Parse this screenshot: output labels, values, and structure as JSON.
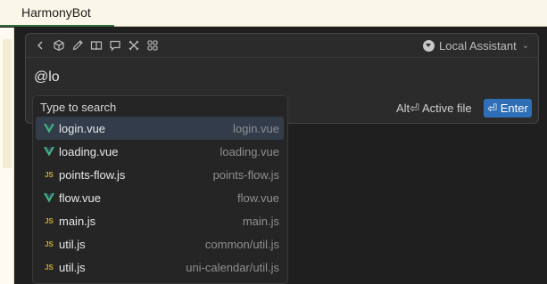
{
  "window": {
    "title": "HarmonyBot"
  },
  "toolbar": {
    "icons": [
      "chevron-left-icon",
      "cube-icon",
      "pencil-icon",
      "book-icon",
      "comment-icon",
      "tools-icon",
      "grid-icon"
    ],
    "assistant": {
      "label": "Local Assistant",
      "icon": "assistant-icon",
      "chevron": "⌄"
    }
  },
  "input": {
    "value": "@lo"
  },
  "actions": {
    "active_file": "Alt⏎ Active file",
    "enter": "⏎ Enter"
  },
  "dropdown": {
    "header": "Type to search",
    "items": [
      {
        "name": "login.vue",
        "path": "login.vue",
        "type": "vue",
        "selected": true
      },
      {
        "name": "loading.vue",
        "path": "loading.vue",
        "type": "vue",
        "selected": false
      },
      {
        "name": "points-flow.js",
        "path": "points-flow.js",
        "type": "js",
        "selected": false
      },
      {
        "name": "flow.vue",
        "path": "flow.vue",
        "type": "vue",
        "selected": false
      },
      {
        "name": "main.js",
        "path": "main.js",
        "type": "js",
        "selected": false
      },
      {
        "name": "util.js",
        "path": "common/util.js",
        "type": "js",
        "selected": false
      },
      {
        "name": "util.js",
        "path": "uni-calendar/util.js",
        "type": "js",
        "selected": false
      }
    ]
  },
  "colors": {
    "accent": "#2f6fb7",
    "vue_green": "#41b883",
    "vue_dark": "#35495e",
    "js_yellow": "#c9a92d",
    "selected_bg": "#323c4b"
  },
  "file_type_labels": {
    "js": "JS"
  }
}
